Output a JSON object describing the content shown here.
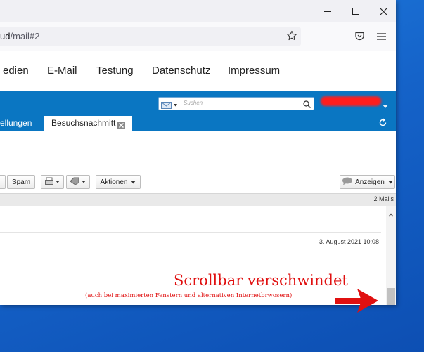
{
  "browser": {
    "url_main": "ud",
    "url_rest": "/mail#2",
    "window_controls": [
      "minimize-icon",
      "maximize-icon",
      "close-icon"
    ],
    "toolbar_icons": [
      "bookmark-star-icon",
      "pocket-icon",
      "menu-icon"
    ]
  },
  "site_nav": {
    "items": [
      "edien",
      "E-Mail",
      "Testung",
      "Datenschutz",
      "Impressum"
    ]
  },
  "mail_header": {
    "search_placeholder": "Suchen",
    "tabs": [
      {
        "label": "ellungen",
        "active": false
      },
      {
        "label": "Besuchsnachmitt",
        "active": true
      }
    ]
  },
  "toolbar": {
    "spam_label": "Spam",
    "actions_label": "Aktionen",
    "view_label": "Anzeigen"
  },
  "list": {
    "count_label": "2 Mails",
    "rows": [
      {
        "date": "3. August 2021 10:08"
      }
    ]
  },
  "annotation": {
    "title": "Scrollbar verschwindet",
    "subtitle": "(auch bei maximierten Fenstern und alternativen Internetbrwosern)"
  },
  "colors": {
    "brand_blue": "#0a76c2",
    "annotation_red": "#e01010",
    "desktop_blue": "#1563c9"
  }
}
